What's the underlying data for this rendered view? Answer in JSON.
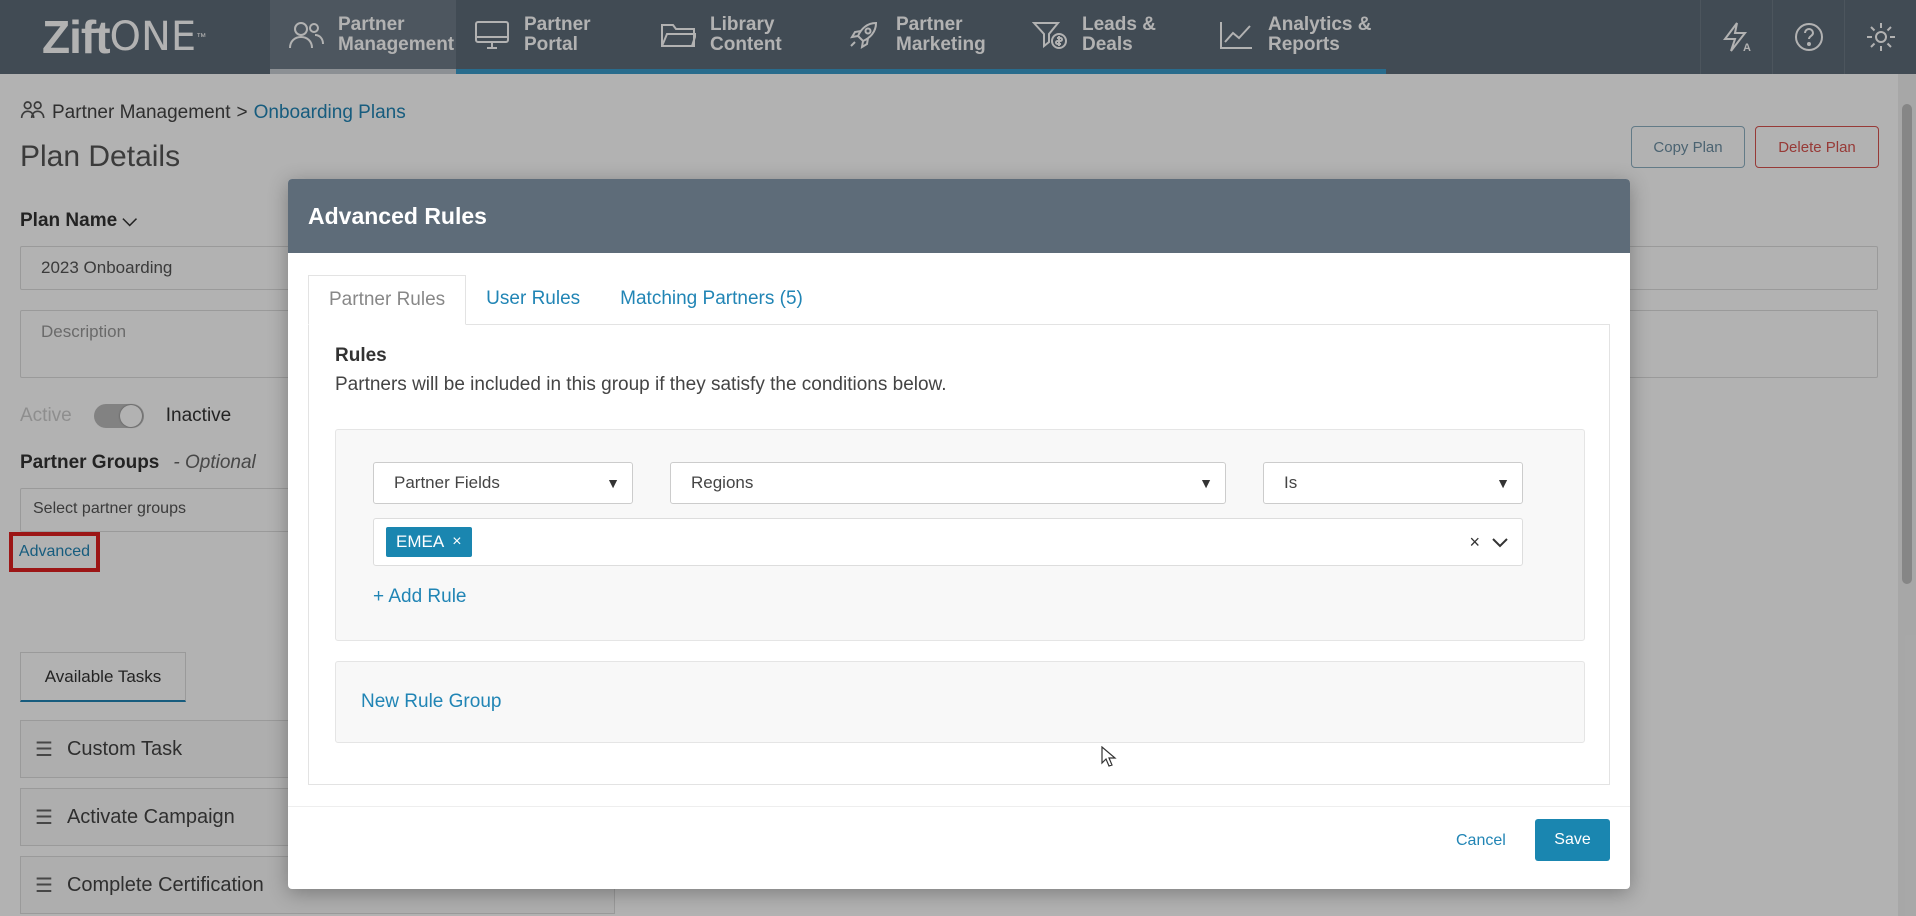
{
  "app": {
    "logo_main": "Zift",
    "logo_suffix": "ONE",
    "logo_tm": "™"
  },
  "nav": {
    "items": [
      {
        "line1": "Partner",
        "line2": "Management",
        "icon": "people-icon"
      },
      {
        "line1": "Partner",
        "line2": "Portal",
        "icon": "monitor-icon"
      },
      {
        "line1": "Library",
        "line2": "Content",
        "icon": "folder-icon"
      },
      {
        "line1": "Partner",
        "line2": "Marketing",
        "icon": "rocket-icon"
      },
      {
        "line1": "Leads &",
        "line2": "Deals",
        "icon": "funnel-dollar-icon"
      },
      {
        "line1": "Analytics &",
        "line2": "Reports",
        "icon": "line-chart-icon"
      }
    ],
    "right_icons": [
      "lightning-a-icon",
      "help-icon",
      "gear-icon"
    ]
  },
  "page": {
    "breadcrumb_root": "Partner Management",
    "breadcrumb_sep": ">",
    "breadcrumb_current": "Onboarding Plans",
    "title": "Plan Details",
    "copy_plan": "Copy Plan",
    "delete_plan": "Delete Plan",
    "plan_name_label": "Plan Name",
    "plan_name_value": "2023 Onboarding",
    "description_placeholder": "Description",
    "active_label": "Active",
    "inactive_label": "Inactive",
    "partner_groups_label": "Partner Groups",
    "optional_label": "- Optional",
    "partner_groups_placeholder": "Select partner groups",
    "advanced_link": "Advanced",
    "available_tasks_tab": "Available Tasks",
    "tasks": [
      "Custom Task",
      "Activate Campaign",
      "Complete Certification"
    ]
  },
  "modal": {
    "title": "Advanced Rules",
    "tabs": [
      "Partner Rules",
      "User Rules",
      "Matching Partners (5)"
    ],
    "rules_heading": "Rules",
    "rules_description": "Partners will be included in this group if they satisfy the conditions below.",
    "rule": {
      "field_type": "Partner Fields",
      "field": "Regions",
      "operator": "Is",
      "values": [
        "EMEA"
      ]
    },
    "add_rule": "+ Add Rule",
    "new_rule_group": "New Rule Group",
    "cancel": "Cancel",
    "save": "Save"
  },
  "colors": {
    "nav_bg": "#5e6c79",
    "accent": "#1a86b0",
    "link": "#2185b5",
    "danger": "#d9534f",
    "highlight_box": "#e02020"
  }
}
